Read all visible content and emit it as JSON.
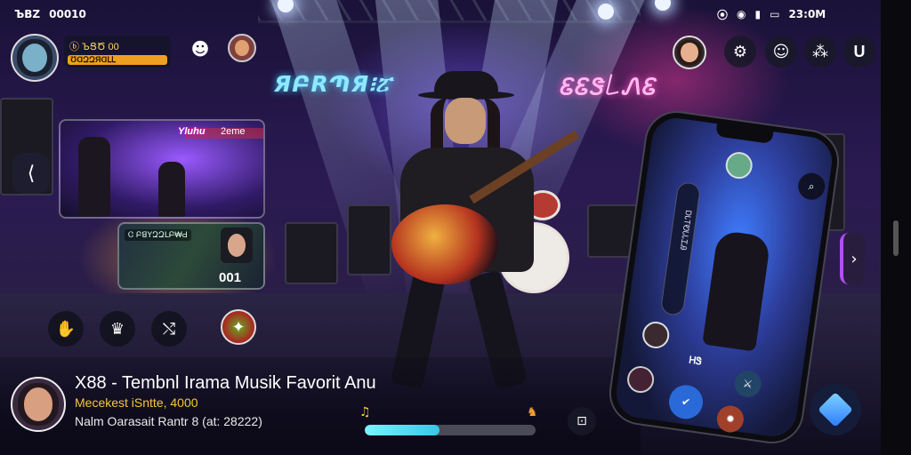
{
  "status_bar": {
    "left_time": "ЪВZ",
    "left_counter": "00010",
    "right_time": "23:0M"
  },
  "profile": {
    "line1": "ⓑ ЪՑԾ 00",
    "xp_label": "ƱⱭԶԶЯⱭԼԼ"
  },
  "stage_signs": {
    "left": "ЯԲRՊЯ፧ፘ",
    "right": "ᏋᏋᏕ꒒ᏁᏋ"
  },
  "clip_one": {
    "tag_left": "Yluhu",
    "tag_right": "2eme"
  },
  "clip_two": {
    "label": "Ꮳ ԲꓭꓬԶԶԼԲ₩Ԁ",
    "count": "001"
  },
  "song": {
    "title": "X88 - Tembnl Irama Musik Favorit  Anu",
    "subtitle": "Mecekest iSntte, 4000",
    "meta": "Nalm Oarasait  Rantr 8 (at: 28222)"
  },
  "player": {
    "progress": 0.44
  },
  "phone": {
    "badge_label": "ᎻᏕ",
    "side_text": "ᎠᏓᎢᏬᏓᏓᏆᎯ"
  },
  "icons": {
    "back": "back-chevron-icon",
    "share": "share-icon",
    "gift": "gift-icon",
    "settings": "gear-icon",
    "user": "user-icon"
  },
  "colors": {
    "accent_gold": "#f0a020",
    "accent_cyan": "#39c6e6",
    "accent_purple": "#b44dff"
  }
}
